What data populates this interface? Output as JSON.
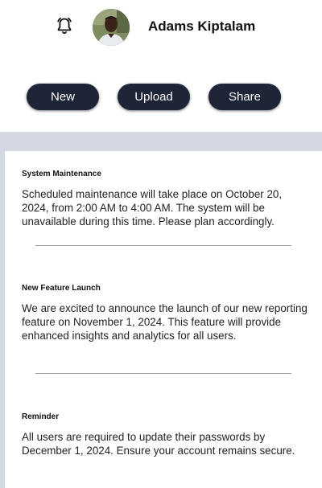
{
  "header": {
    "bell_icon": "bell-icon",
    "user_name": "Adams Kiptalam",
    "avatar_icon": "user-avatar"
  },
  "actions": {
    "new_label": "New",
    "upload_label": "Upload",
    "share_label": "Share"
  },
  "notices": [
    {
      "title": "System Maintenance",
      "body": "Scheduled maintenance will take place on October 20, 2024, from 2:00 AM to 4:00 AM. The system will be unavailable during this time. Please plan accordingly."
    },
    {
      "title": "New Feature Launch",
      "body": "We are excited to announce the launch of our new reporting feature on November 1, 2024. This feature will provide enhanced insights and analytics for all users."
    },
    {
      "title": "Reminder",
      "body": "All users are required to update their passwords by December 1, 2024. Ensure your account remains secure."
    }
  ],
  "colors": {
    "button_bg": "#1d2536",
    "feed_bg": "#d4d8e2"
  }
}
